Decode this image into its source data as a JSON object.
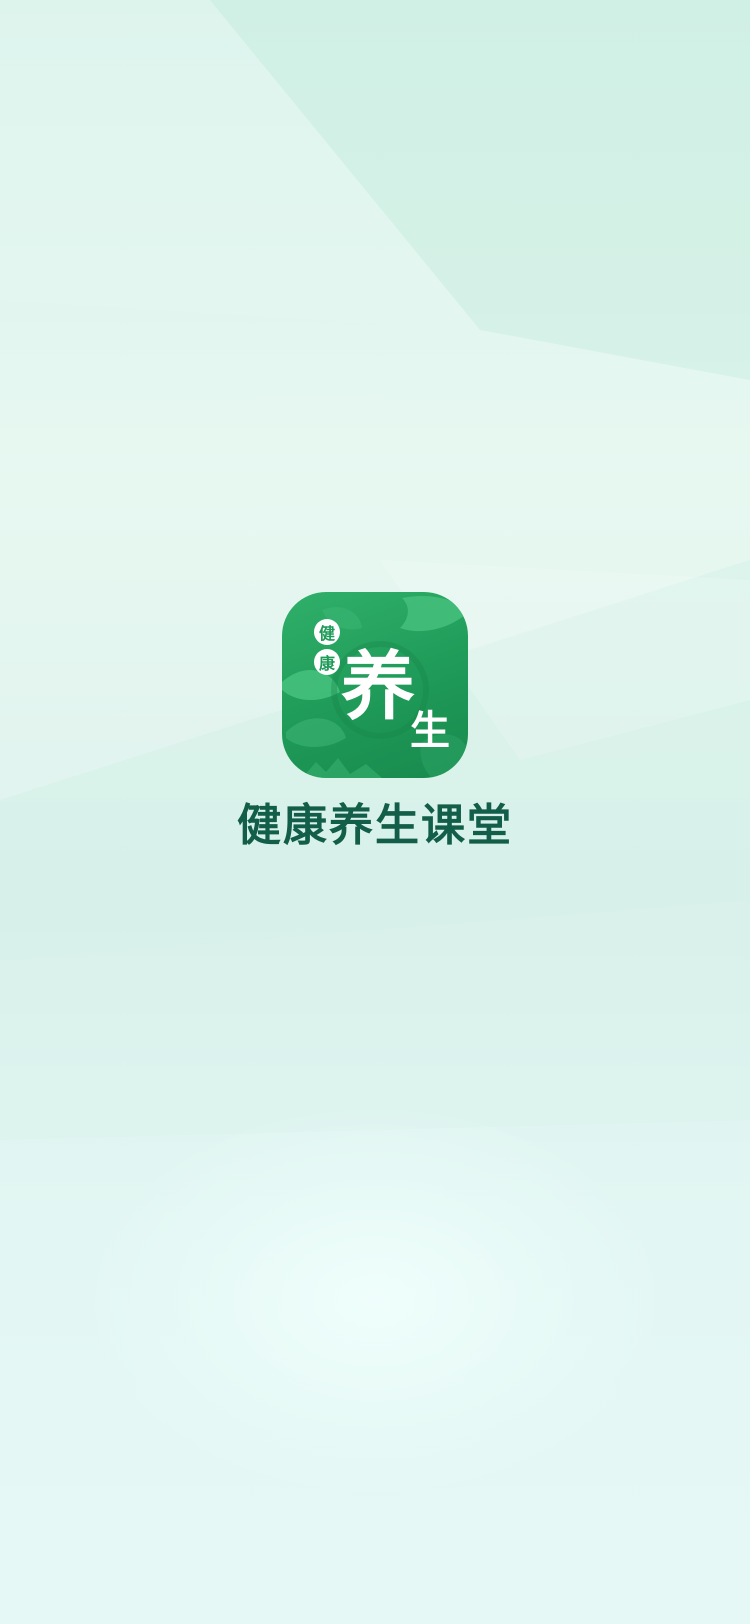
{
  "app": {
    "title": "健康养生课堂",
    "icon": {
      "name": "app-logo",
      "small_text_1": "健",
      "small_text_2": "康",
      "big_text_1": "养",
      "big_text_2": "生"
    }
  },
  "colors": {
    "title": "#135e48",
    "icon_green": "#1f9a58",
    "background": "#dcf2ec"
  }
}
